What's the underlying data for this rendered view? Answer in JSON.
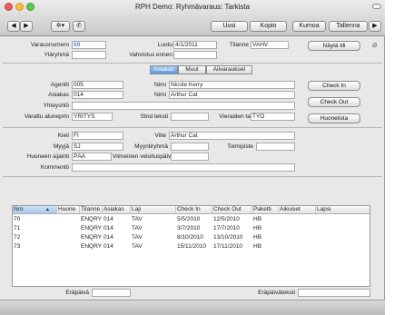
{
  "window": {
    "title": "RPH Demo: Ryhmävaraus: Tarkista"
  },
  "toolbar": {
    "prev": "◀",
    "next": "▶",
    "action_menu": "✲▾",
    "phone": "✆",
    "buttons": [
      "Uusi",
      "Kopio",
      "Kumoa",
      "Tallenna"
    ],
    "end": "▶"
  },
  "header": {
    "varausnumero_label": "Varausnumero",
    "varausnumero": "69",
    "ylaryhma_label": "Yläryhmä",
    "ylaryhma": "",
    "luotu_label": "Luotu",
    "luotu": "4/1/2011",
    "vahvistus_label": "Vahvistus ennen",
    "vahvistus": "",
    "tilanne_label": "Tilanne",
    "tilanne": "VAHV",
    "nayta_tili": "Näytä tili"
  },
  "tabs": [
    {
      "label": "Asiakas",
      "active": true
    },
    {
      "label": "Muut",
      "active": false
    },
    {
      "label": "Alivaraukset",
      "active": false
    }
  ],
  "asiakas": {
    "agentti_label": "Agentti",
    "agentti": "005",
    "nimi1_label": "Nimi",
    "nimi1": "Nicole Kerry",
    "asiakas_label": "Asiakas",
    "asiakas": "014",
    "nimi2_label": "Nimi",
    "nimi2": "Arthur Cat",
    "yhteyshlo_label": "Yhteyshlö",
    "yhteyshlo": "",
    "varattu_label": "Varattu aluneprin",
    "varattu": "YRITYS",
    "stnd_label": "Stnd teksti",
    "stnd": "",
    "vieraiden_label": "Vieraiden tarkoitus",
    "vieraiden": "TYÖ",
    "check_in": "Check In",
    "check_out": "Check Out",
    "huonelista": "Huonelista"
  },
  "details": {
    "kieli_label": "Kieli",
    "kieli": "FI",
    "viite_label": "Viite",
    "viite": "Arthur Cat",
    "myyja_label": "Myyjä",
    "myyja": "SJ",
    "myyntiryhma_label": "Myyntiryhmä",
    "myyntiryhma": "",
    "toimipiste_label": "Toimipiste",
    "toimipiste": "",
    "sijainti_label": "Huoneen sijainti",
    "sijainti": "PÄÄ",
    "veloitus_label": "Viimeinen veloituspäivä",
    "veloitus": "",
    "kommentti_label": "Kommentti",
    "kommentti": ""
  },
  "table": {
    "columns": [
      "Nro",
      "Huone",
      "Tilanne",
      "Asiakas",
      "Laji",
      "Check In",
      "Check Out",
      "Paketti",
      "Aikuiset",
      "Lapsi"
    ],
    "sort_indicator": "▲",
    "rows": [
      [
        "70",
        "",
        "ENQRY",
        "014",
        "TAV",
        "5/5/2010",
        "12/5/2010",
        "HB",
        "",
        ""
      ],
      [
        "71",
        "",
        "ENQRY",
        "014",
        "TAV",
        "3/7/2010",
        "17/7/2010",
        "HB",
        "",
        ""
      ],
      [
        "72",
        "",
        "ENQRY",
        "014",
        "TAV",
        "8/10/2010",
        "13/10/2010",
        "HB",
        "",
        ""
      ],
      [
        "73",
        "",
        "ENQRY",
        "014",
        "TAV",
        "15/11/2010",
        "17/11/2010",
        "HB",
        "",
        ""
      ]
    ]
  },
  "footer": {
    "erapaiva_label": "Eräpäivä",
    "erapaiva": "",
    "erapaivateksti_label": "Eräpäiväteksti",
    "erapaivateksti": ""
  },
  "colors": {
    "accent": "#5e9be0",
    "value_blue": "#2a4fb0",
    "close": "#ec5b55",
    "minimize": "#f4bd40",
    "zoom": "#5fc64f"
  }
}
